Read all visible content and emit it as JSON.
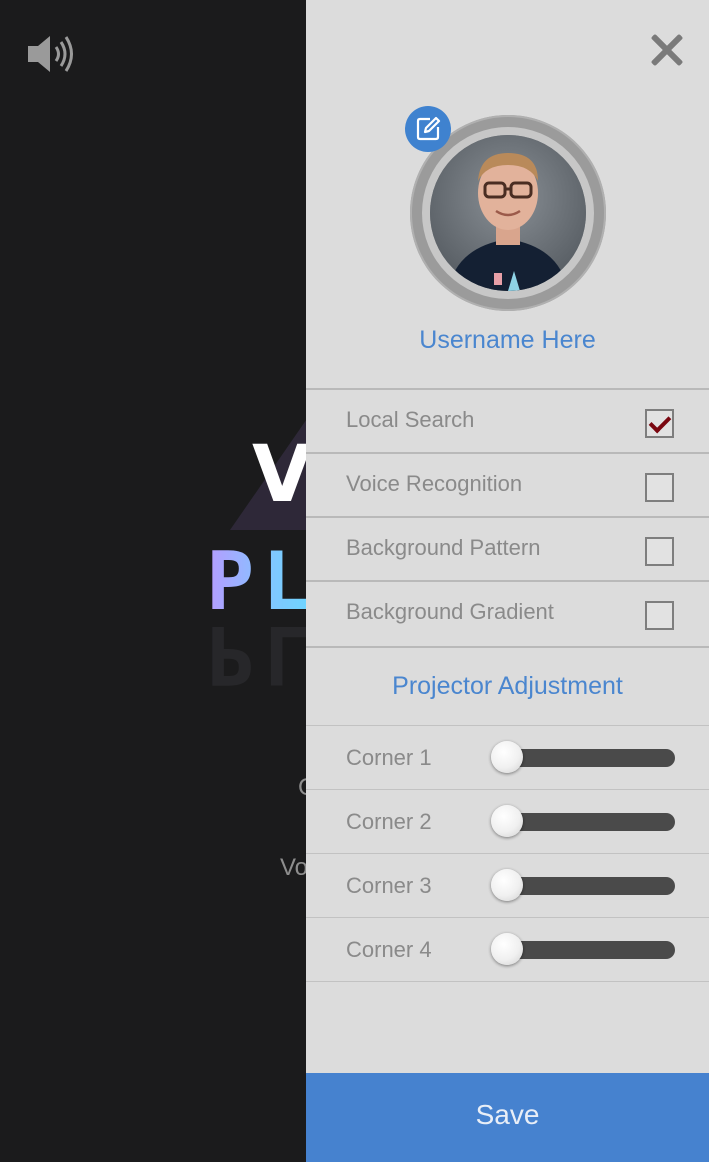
{
  "background": {
    "logo_letter": "V",
    "logo_word": "PL",
    "partial_text_1": "C",
    "partial_text_2": "Vo"
  },
  "panel": {
    "username": "Username Here",
    "toggles": [
      {
        "label": "Local Search",
        "checked": true
      },
      {
        "label": "Voice Recognition",
        "checked": false
      },
      {
        "label": "Background Pattern",
        "checked": false
      },
      {
        "label": "Background Gradient",
        "checked": false
      }
    ],
    "section_title": "Projector Adjustment",
    "sliders": [
      {
        "label": "Corner 1",
        "value": 0
      },
      {
        "label": "Corner 2",
        "value": 0
      },
      {
        "label": "Corner 3",
        "value": 0
      },
      {
        "label": "Corner 4",
        "value": 0
      }
    ],
    "save_label": "Save"
  },
  "colors": {
    "accent": "#4682cf",
    "panel_bg": "#dcdcdc",
    "app_bg": "#1b1b1c",
    "check_mark": "#7a0710"
  },
  "icons": {
    "volume": "speaker-volume-icon",
    "close": "close-icon",
    "edit": "edit-icon"
  }
}
